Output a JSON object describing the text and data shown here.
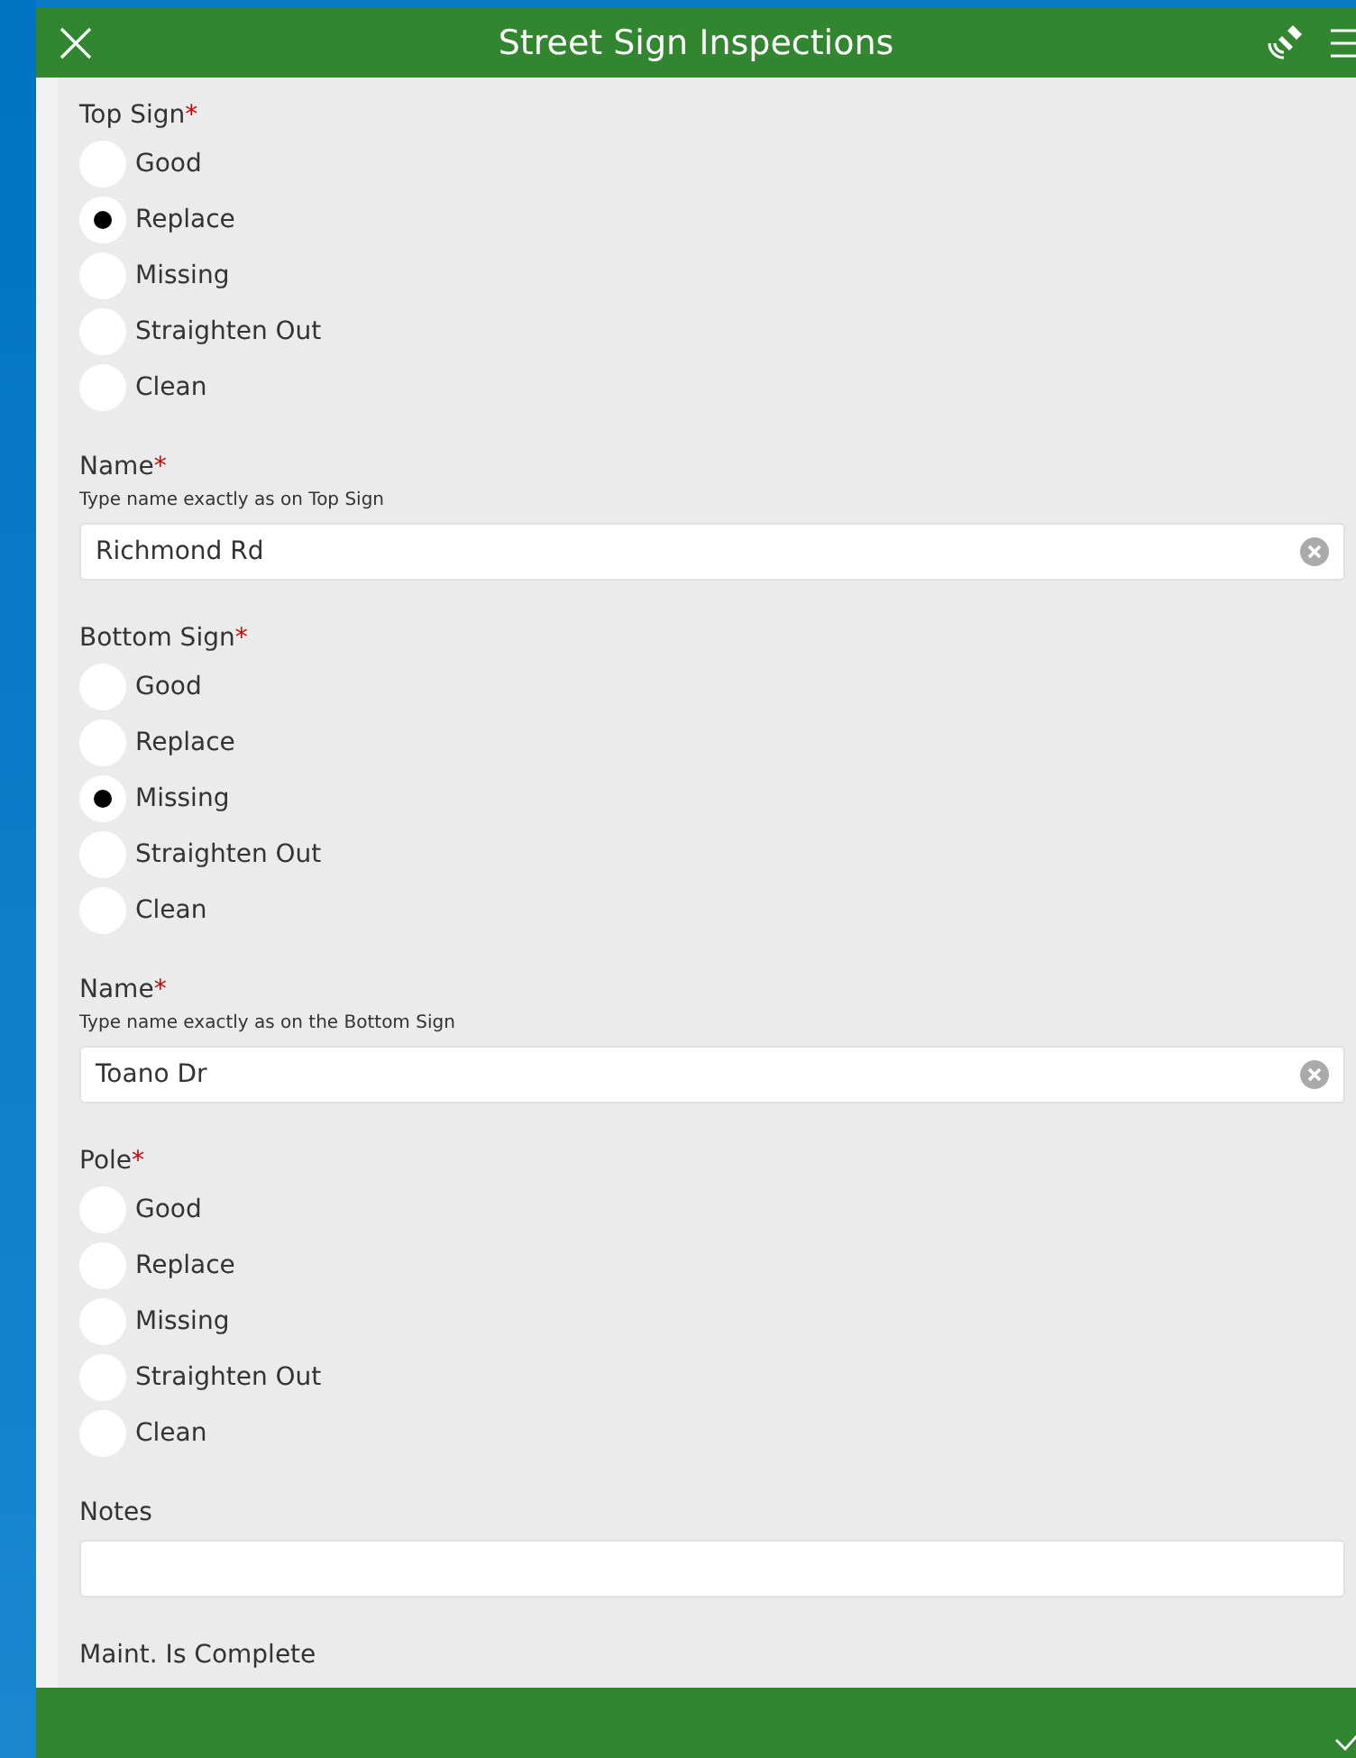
{
  "header": {
    "title": "Street Sign Inspections"
  },
  "fields": [
    {
      "kind": "radio",
      "label": "Top Sign",
      "required_mark": "*",
      "options": [
        {
          "label": "Good",
          "selected": false
        },
        {
          "label": "Replace",
          "selected": true
        },
        {
          "label": "Missing",
          "selected": false
        },
        {
          "label": "Straighten Out",
          "selected": false
        },
        {
          "label": "Clean",
          "selected": false
        }
      ]
    },
    {
      "kind": "text",
      "label": "Name",
      "required_mark": "*",
      "hint": "Type name exactly as on Top Sign",
      "value": "Richmond Rd"
    },
    {
      "kind": "radio",
      "label": "Bottom Sign",
      "required_mark": "*",
      "options": [
        {
          "label": "Good",
          "selected": false
        },
        {
          "label": "Replace",
          "selected": false
        },
        {
          "label": "Missing",
          "selected": true
        },
        {
          "label": "Straighten Out",
          "selected": false
        },
        {
          "label": "Clean",
          "selected": false
        }
      ]
    },
    {
      "kind": "text",
      "label": "Name",
      "required_mark": "*",
      "hint": "Type name exactly as on the Bottom Sign",
      "value": "Toano Dr"
    },
    {
      "kind": "radio",
      "label": "Pole",
      "required_mark": "*",
      "options": [
        {
          "label": "Good",
          "selected": false
        },
        {
          "label": "Replace",
          "selected": false
        },
        {
          "label": "Missing",
          "selected": false
        },
        {
          "label": "Straighten Out",
          "selected": false
        },
        {
          "label": "Clean",
          "selected": false
        }
      ]
    },
    {
      "kind": "text",
      "label": "Notes"
    },
    {
      "kind": "heading",
      "label": "Maint. Is Complete"
    }
  ]
}
